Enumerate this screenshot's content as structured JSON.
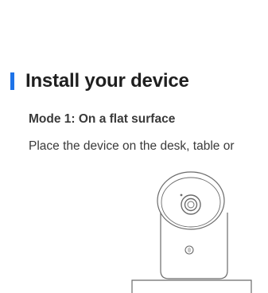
{
  "colors": {
    "accent": "#1e73e8",
    "text_dark": "#1f1f1f",
    "text_body": "#3a3a3a",
    "line": "#6b6b6b"
  },
  "heading": {
    "title": "Install your device"
  },
  "mode": {
    "subtitle": "Mode 1: On a flat surface",
    "description": "Place the device on the desk, table or"
  },
  "illustration": {
    "icon": "camera-on-surface-icon"
  }
}
